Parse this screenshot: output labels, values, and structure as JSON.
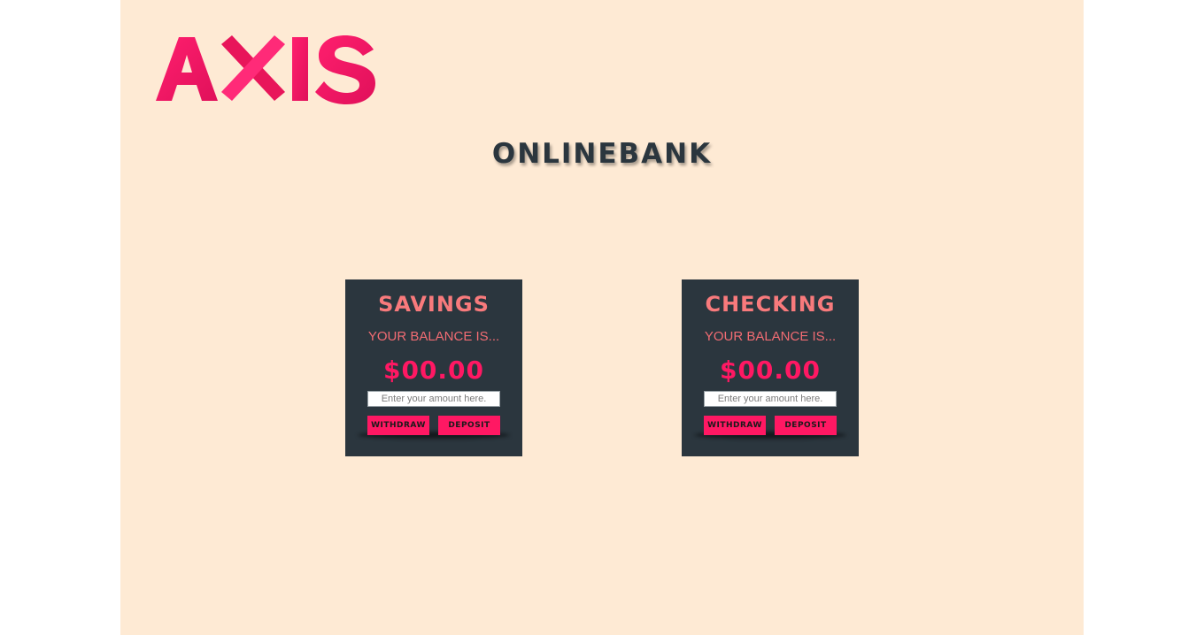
{
  "header": {
    "logo_text": "AXIS",
    "site_title": "ONLINEBANK"
  },
  "accounts": [
    {
      "title": "SAVINGS",
      "balance_label": "YOUR BALANCE IS...",
      "balance": "$00.00",
      "input_placeholder": "Enter your amount here.",
      "withdraw_label": "WITHDRAW",
      "deposit_label": "DEPOSIT"
    },
    {
      "title": "CHECKING",
      "balance_label": "YOUR BALANCE IS...",
      "balance": "$00.00",
      "input_placeholder": "Enter your amount here.",
      "withdraw_label": "WITHDRAW",
      "deposit_label": "DEPOSIT"
    }
  ],
  "colors": {
    "page_background": "#feead4",
    "card_background": "#2b363e",
    "accent": "#ff1863",
    "title_salmon": "#f87a7c",
    "logo_gradient_start": "#e8155a",
    "logo_gradient_end": "#ff2a8a"
  }
}
